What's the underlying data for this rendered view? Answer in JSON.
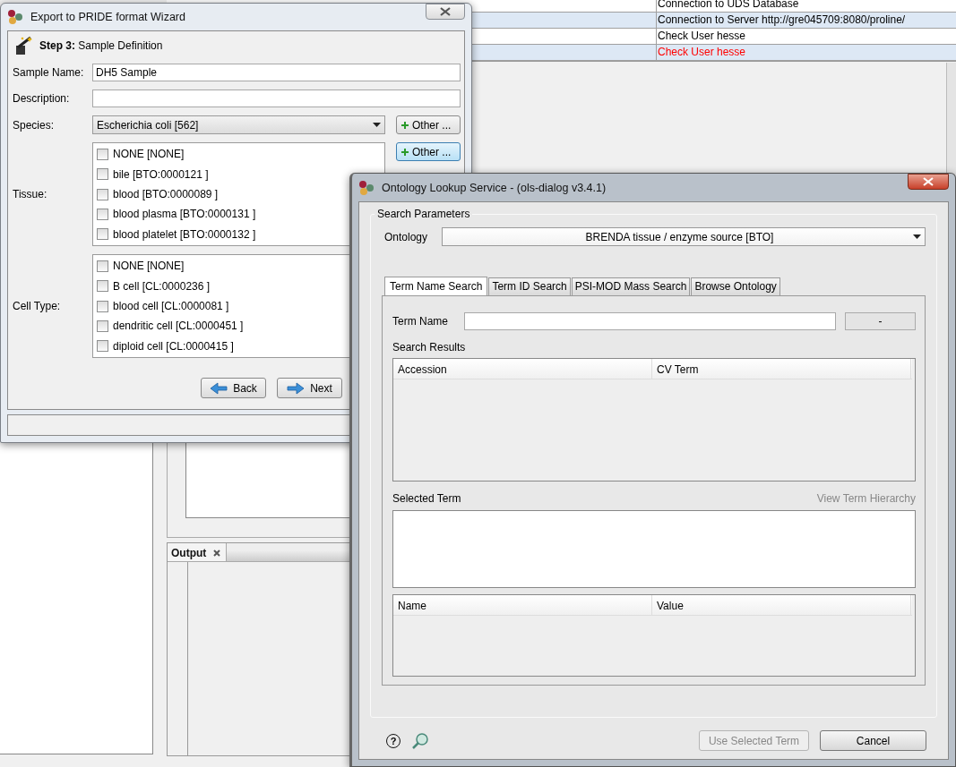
{
  "background": {
    "log_rows": [
      {
        "text": "Connection to UDS Database",
        "error": false
      },
      {
        "text": "Connection to Server http://gre045709:8080/proline/",
        "error": false
      },
      {
        "text": "Check User hesse",
        "error": false
      },
      {
        "text": "Check User hesse",
        "error": true
      }
    ],
    "output_tab": "Output"
  },
  "wizard": {
    "title": "Export to PRIDE format Wizard",
    "step_label": "Step 3:",
    "step_title": "Sample Definition",
    "sample_name": {
      "label": "Sample Name:",
      "value": "DH5 Sample"
    },
    "description": {
      "label": "Description:"
    },
    "species": {
      "label": "Species:",
      "value": "Escherichia coli [562]",
      "button": "Other ..."
    },
    "tissue": {
      "label": "Tissue:",
      "button": "Other ...",
      "items": [
        {
          "label": "NONE [NONE]",
          "checked": false
        },
        {
          "label": "bile [BTO:0000121 ]",
          "checked": false
        },
        {
          "label": "blood [BTO:0000089 ]",
          "checked": false
        },
        {
          "label": "blood plasma [BTO:0000131 ]",
          "checked": false
        },
        {
          "label": "blood platelet [BTO:0000132 ]",
          "checked": false
        }
      ]
    },
    "cell_type": {
      "label": "Cell Type:",
      "items": [
        {
          "label": "NONE [NONE]",
          "checked": false
        },
        {
          "label": "B cell [CL:0000236 ]",
          "checked": false
        },
        {
          "label": "blood cell [CL:0000081 ]",
          "checked": false
        },
        {
          "label": "dendritic cell [CL:0000451 ]",
          "checked": false
        },
        {
          "label": "diploid cell [CL:0000415 ]",
          "checked": false
        }
      ]
    },
    "back": "Back",
    "next": "Next"
  },
  "ols": {
    "title": "Ontology Lookup Service - (ols-dialog v3.4.1)",
    "group": "Search Parameters",
    "ontology_label": "Ontology",
    "ontology_value": "BRENDA tissue / enzyme source [BTO]",
    "tabs": [
      {
        "label": "Term Name Search",
        "selected": true
      },
      {
        "label": "Term ID Search",
        "selected": false
      },
      {
        "label": "PSI-MOD Mass Search",
        "selected": false
      },
      {
        "label": "Browse Ontology",
        "selected": false
      }
    ],
    "term_name_label": "Term Name",
    "search_button": "-",
    "search_results_label": "Search Results",
    "results_columns": [
      "Accession",
      "CV Term"
    ],
    "selected_term_label": "Selected Term",
    "hierarchy_link": {
      "label": "View Term Hierarchy",
      "disabled": true
    },
    "details_columns": [
      "Name",
      "Value"
    ],
    "help_button": "?",
    "use_button": {
      "label": "Use Selected Term",
      "disabled": true
    },
    "cancel": "Cancel"
  }
}
